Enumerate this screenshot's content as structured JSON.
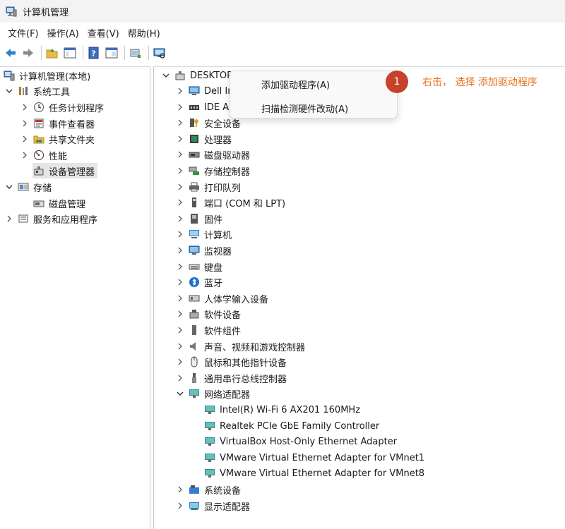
{
  "window": {
    "title": "计算机管理"
  },
  "menubar": {
    "items": [
      "文件(F)",
      "操作(A)",
      "查看(V)",
      "帮助(H)"
    ]
  },
  "left_tree": {
    "root": "计算机管理(本地)",
    "system_tools": "系统工具",
    "task_scheduler": "任务计划程序",
    "event_viewer": "事件查看器",
    "shared_folders": "共享文件夹",
    "performance": "性能",
    "device_manager": "设备管理器",
    "storage": "存储",
    "disk_management": "磁盘管理",
    "services_apps": "服务和应用程序"
  },
  "device_tree": {
    "root": "DESKTOP-",
    "categories": [
      "Dell In",
      "IDE A",
      "安全设备",
      "处理器",
      "磁盘驱动器",
      "存储控制器",
      "打印队列",
      "端口 (COM 和 LPT)",
      "固件",
      "计算机",
      "监视器",
      "键盘",
      "蓝牙",
      "人体学输入设备",
      "软件设备",
      "软件组件",
      "声音、视频和游戏控制器",
      "鼠标和其他指针设备",
      "通用串行总线控制器",
      "网络适配器"
    ],
    "network_adapters": [
      "Intel(R) Wi-Fi 6 AX201 160MHz",
      "Realtek PCIe GbE Family Controller",
      "VirtualBox Host-Only Ethernet Adapter",
      "VMware Virtual Ethernet Adapter for VMnet1",
      "VMware Virtual Ethernet Adapter for VMnet8"
    ],
    "after_categories": [
      "系统设备",
      "显示适配器"
    ]
  },
  "context_menu": {
    "add_driver": "添加驱动程序(A)",
    "scan_hardware": "扫描检测硬件改动(A)"
  },
  "annotation": {
    "step_number": "1",
    "text": "右击， 选择 添加驱动程序",
    "color": "#e8711c",
    "badge_color": "#c8412a"
  }
}
